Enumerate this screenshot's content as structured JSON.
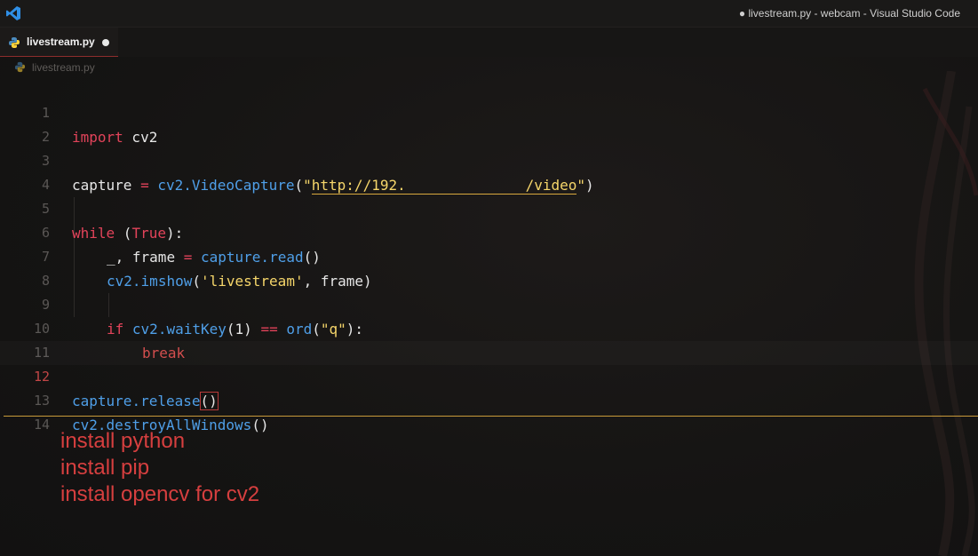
{
  "window": {
    "title": "● livestream.py - webcam - Visual Studio Code"
  },
  "tab": {
    "label": "livestream.py",
    "icon": "python-icon",
    "dirty": true
  },
  "breadcrumb": {
    "label": "livestream.py"
  },
  "editor": {
    "active_line": 12,
    "line_numbers": [
      "1",
      "2",
      "3",
      "4",
      "5",
      "6",
      "7",
      "8",
      "9",
      "10",
      "11",
      "12",
      "13",
      "14"
    ],
    "lines": {
      "l1": [
        "import",
        " cv2"
      ],
      "l3": [
        "capture",
        " = ",
        "cv2",
        ".",
        "VideoCapture",
        "(",
        "\"",
        "http://192.",
        "              ",
        "/video",
        "\"",
        ")"
      ],
      "l5": [
        "while",
        " (",
        "True",
        "):"
      ],
      "l6": [
        "_",
        ", ",
        "frame",
        " = ",
        "capture",
        ".",
        "read",
        "()"
      ],
      "l7": [
        "cv2",
        ".",
        "imshow",
        "(",
        "'livestream'",
        ", ",
        "frame",
        ")"
      ],
      "l9": [
        "if",
        " ",
        "cv2",
        ".",
        "waitKey",
        "(",
        "1",
        ")",
        " == ",
        "ord",
        "(",
        "\"q\"",
        "):"
      ],
      "l10": [
        "break"
      ],
      "l12": [
        "capture",
        ".",
        "release",
        "()"
      ],
      "l13": [
        "cv2",
        ".",
        "destroyAllWindows",
        "()"
      ]
    }
  },
  "notes": [
    "install python",
    "install pip",
    "install opencv for cv2"
  ],
  "colors": {
    "keyword": "#e2435a",
    "function": "#4f9fe8",
    "string": "#f6d66a",
    "note_text": "#d63f3f",
    "separator": "#c89a3a"
  }
}
